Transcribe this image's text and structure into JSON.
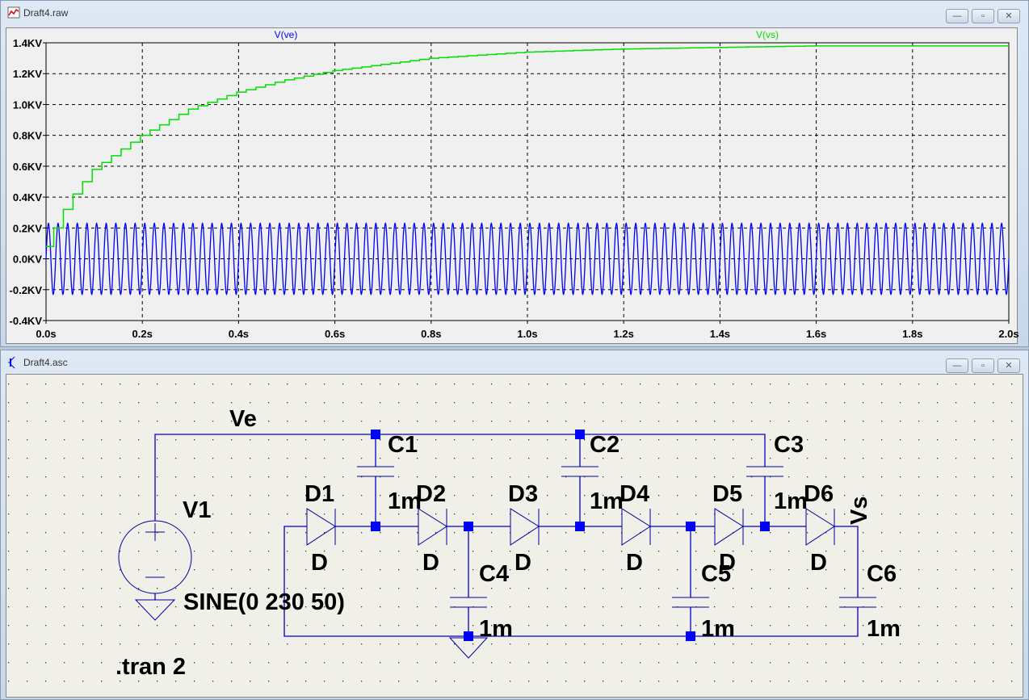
{
  "plot_window": {
    "title": "Draft4.raw",
    "minimize": "—",
    "maximize": "▫",
    "close": "✕"
  },
  "schematic_window": {
    "title": "Draft4.asc",
    "minimize": "—",
    "maximize": "▫",
    "close": "✕"
  },
  "chart_data": {
    "type": "line",
    "xlabel": "",
    "ylabel": "",
    "xlim": [
      0,
      2.0
    ],
    "ylim": [
      -0.4,
      1.4
    ],
    "x_ticks": [
      "0.0s",
      "0.2s",
      "0.4s",
      "0.6s",
      "0.8s",
      "1.0s",
      "1.2s",
      "1.4s",
      "1.6s",
      "1.8s",
      "2.0s"
    ],
    "y_ticks": [
      "1.4KV",
      "1.2KV",
      "1.0KV",
      "0.8KV",
      "0.6KV",
      "0.4KV",
      "0.2KV",
      "0.0KV",
      "-0.2KV",
      "-0.4KV"
    ],
    "grid": true,
    "series": [
      {
        "name": "V(ve)",
        "color": "#0000ff",
        "kind": "sine",
        "amplitude_kv": 0.23,
        "frequency_hz": 50
      },
      {
        "name": "V(vs)",
        "color": "#00e000",
        "kind": "staircase",
        "t": [
          0,
          0.02,
          0.05,
          0.1,
          0.2,
          0.3,
          0.4,
          0.5,
          0.6,
          0.8,
          1.0,
          1.2,
          1.4,
          1.6,
          2.0
        ],
        "v": [
          0.08,
          0.2,
          0.38,
          0.58,
          0.8,
          0.97,
          1.08,
          1.16,
          1.22,
          1.3,
          1.34,
          1.36,
          1.37,
          1.38,
          1.38
        ]
      }
    ]
  },
  "schematic": {
    "net_ve": "Ve",
    "net_vs": "Vs",
    "source_name": "V1",
    "source_value": "SINE(0 230 50)",
    "directive": ".tran 2",
    "diodes": [
      {
        "name": "D1",
        "model": "D"
      },
      {
        "name": "D2",
        "model": "D"
      },
      {
        "name": "D3",
        "model": "D"
      },
      {
        "name": "D4",
        "model": "D"
      },
      {
        "name": "D5",
        "model": "D"
      },
      {
        "name": "D6",
        "model": "D"
      }
    ],
    "capacitors": [
      {
        "name": "C1",
        "value": "1m"
      },
      {
        "name": "C2",
        "value": "1m"
      },
      {
        "name": "C3",
        "value": "1m"
      },
      {
        "name": "C4",
        "value": "1m"
      },
      {
        "name": "C5",
        "value": "1m"
      },
      {
        "name": "C6",
        "value": "1m"
      }
    ]
  }
}
